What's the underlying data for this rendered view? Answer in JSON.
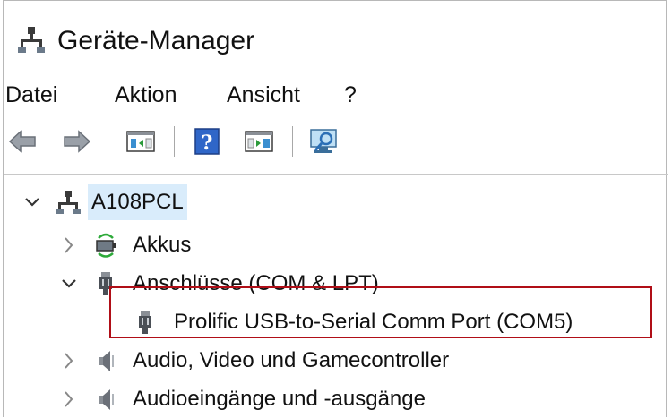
{
  "window": {
    "title": "Geräte-Manager"
  },
  "menu": {
    "items": [
      "Datei",
      "Aktion",
      "Ansicht",
      "?"
    ]
  },
  "toolbar": {
    "buttons": [
      "back-icon",
      "forward-icon",
      "show-hide-console-tree-icon",
      "help-icon",
      "show-hide-action-pane-icon",
      "scan-hardware-icon"
    ]
  },
  "tree": {
    "root": {
      "label": "A108PCL",
      "expanded": true
    },
    "items": [
      {
        "label": "Akkus",
        "expanded": false
      },
      {
        "label": "Anschlüsse (COM & LPT)",
        "expanded": true
      },
      {
        "label": "Prolific USB-to-Serial Comm Port (COM5)",
        "child": true,
        "highlighted": true
      },
      {
        "label": "Audio, Video und Gamecontroller",
        "expanded": false
      },
      {
        "label": "Audioeingänge und -ausgänge",
        "expanded": false
      }
    ]
  },
  "colors": {
    "highlight_border": "#b00e17",
    "selection_bg": "#d9ecfb"
  }
}
